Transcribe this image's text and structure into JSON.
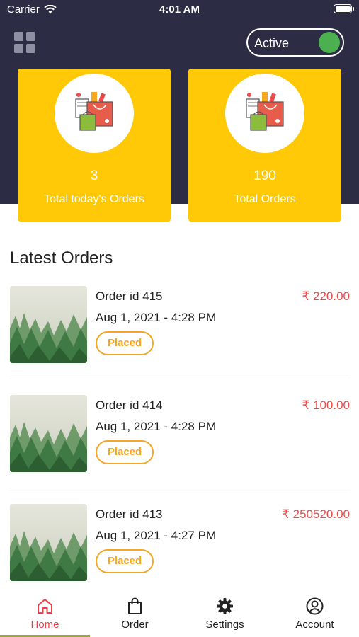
{
  "status_bar": {
    "carrier": "Carrier",
    "time": "4:01 AM"
  },
  "header": {
    "toggle_label": "Active",
    "toggle_on": true
  },
  "stats": [
    {
      "value": "3",
      "label": "Total today's Orders"
    },
    {
      "value": "190",
      "label": "Total Orders"
    }
  ],
  "section_title": "Latest Orders",
  "orders": [
    {
      "id": "Order id 415",
      "date": "Aug 1, 2021 - 4:28 PM",
      "amount": "₹  220.00",
      "status": "Placed"
    },
    {
      "id": "Order id 414",
      "date": "Aug 1, 2021 - 4:28 PM",
      "amount": "₹  100.00",
      "status": "Placed"
    },
    {
      "id": "Order id 413",
      "date": "Aug 1, 2021 - 4:27 PM",
      "amount": "₹  250520.00",
      "status": "Placed"
    }
  ],
  "tabs": [
    {
      "label": "Home",
      "icon": "home-icon",
      "active": true
    },
    {
      "label": "Order",
      "icon": "shopping-bag-icon",
      "active": false
    },
    {
      "label": "Settings",
      "icon": "gear-icon",
      "active": false
    },
    {
      "label": "Account",
      "icon": "account-icon",
      "active": false
    }
  ],
  "colors": {
    "header_bg": "#2c2d44",
    "card_bg": "#ffc908",
    "accent_red": "#e8424a",
    "status_orange": "#f5a623",
    "toggle_green": "#4cb050"
  }
}
